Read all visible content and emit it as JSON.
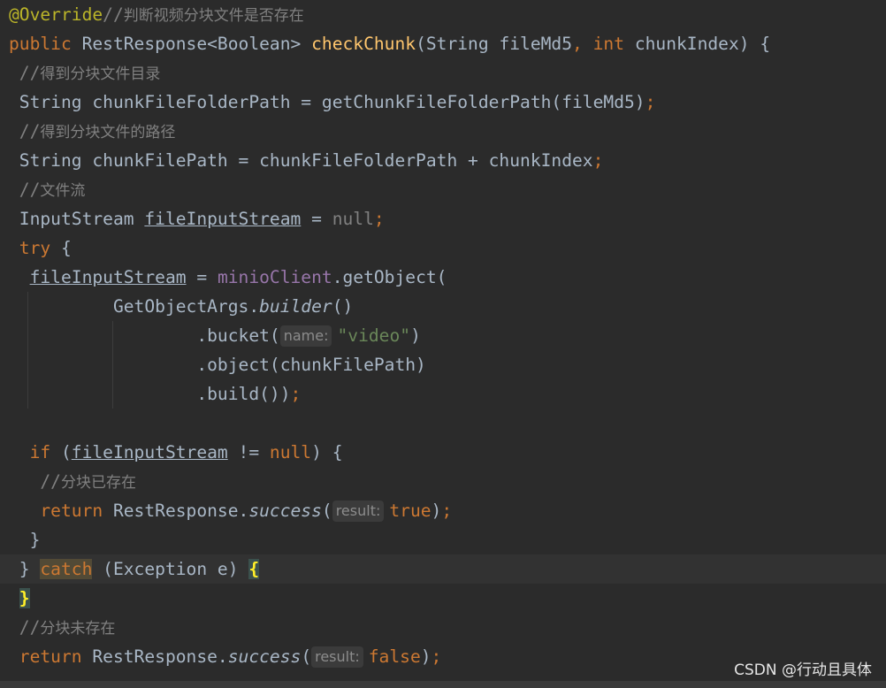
{
  "editor": {
    "lines": [
      {
        "tokens": [
          {
            "c": "ann",
            "t": "@Override"
          },
          {
            "c": "cmt",
            "t": "//"
          },
          {
            "c": "cmt-cjk",
            "t": "判断视频分块文件是否存在"
          }
        ]
      },
      {
        "tokens": [
          {
            "c": "kw",
            "t": "public "
          },
          {
            "c": "",
            "t": "RestResponse<Boolean> "
          },
          {
            "c": "fn",
            "t": "checkChunk"
          },
          {
            "c": "",
            "t": "(String fileMd5"
          },
          {
            "c": "kw",
            "t": ", int "
          },
          {
            "c": "",
            "t": "chunkIndex) {"
          }
        ]
      },
      {
        "tokens": [
          {
            "c": "",
            "t": " "
          },
          {
            "c": "cmt",
            "t": "//"
          },
          {
            "c": "cmt-cjk",
            "t": "得到分块文件目录"
          }
        ]
      },
      {
        "tokens": [
          {
            "c": "",
            "t": " String chunkFileFolderPath = getChunkFileFolderPath(fileMd5)"
          },
          {
            "c": "kw",
            "t": ";"
          }
        ]
      },
      {
        "tokens": [
          {
            "c": "",
            "t": " "
          },
          {
            "c": "cmt",
            "t": "//"
          },
          {
            "c": "cmt-cjk",
            "t": "得到分块文件的路径"
          }
        ]
      },
      {
        "tokens": [
          {
            "c": "",
            "t": " String chunkFilePath = chunkFileFolderPath + chunkIndex"
          },
          {
            "c": "kw",
            "t": ";"
          }
        ]
      },
      {
        "tokens": [
          {
            "c": "",
            "t": " "
          },
          {
            "c": "cmt",
            "t": "//"
          },
          {
            "c": "cmt-cjk",
            "t": "文件流"
          }
        ]
      },
      {
        "tokens": [
          {
            "c": "",
            "t": " InputStream "
          },
          {
            "c": "ul",
            "t": "fileInputStream"
          },
          {
            "c": "",
            "t": " = "
          },
          {
            "c": "nullv",
            "t": "null"
          },
          {
            "c": "kw",
            "t": ";"
          }
        ]
      },
      {
        "tokens": [
          {
            "c": "",
            "t": " "
          },
          {
            "c": "kw",
            "t": "try "
          },
          {
            "c": "",
            "t": "{"
          }
        ]
      },
      {
        "tokens": [
          {
            "c": "",
            "t": "  "
          },
          {
            "c": "ul",
            "t": "fileInputStream"
          },
          {
            "c": "",
            "t": " = "
          },
          {
            "c": "fld",
            "t": "minioClient"
          },
          {
            "c": "",
            "t": ".getObject("
          }
        ]
      },
      {
        "tokens": [
          {
            "c": "",
            "t": "          GetObjectArgs."
          },
          {
            "c": "it",
            "t": "builder"
          },
          {
            "c": "",
            "t": "()"
          }
        ]
      },
      {
        "tokens": [
          {
            "c": "",
            "t": "                  .bucket("
          },
          {
            "c": "hint",
            "t": "name:"
          },
          {
            "c": "str",
            "t": "\"video\""
          },
          {
            "c": "",
            "t": ")"
          }
        ]
      },
      {
        "tokens": [
          {
            "c": "",
            "t": "                  .object(chunkFilePath)"
          }
        ]
      },
      {
        "tokens": [
          {
            "c": "",
            "t": "                  .build())"
          },
          {
            "c": "kw",
            "t": ";"
          }
        ]
      },
      {
        "tokens": []
      },
      {
        "tokens": [
          {
            "c": "",
            "t": "  "
          },
          {
            "c": "kw",
            "t": "if "
          },
          {
            "c": "",
            "t": "("
          },
          {
            "c": "ul",
            "t": "fileInputStream"
          },
          {
            "c": "",
            "t": " != "
          },
          {
            "c": "kw",
            "t": "null"
          },
          {
            "c": "",
            "t": ") {"
          }
        ]
      },
      {
        "tokens": [
          {
            "c": "",
            "t": "   "
          },
          {
            "c": "cmt",
            "t": "//"
          },
          {
            "c": "cmt-cjk",
            "t": "分块已存在"
          }
        ]
      },
      {
        "tokens": [
          {
            "c": "",
            "t": "   "
          },
          {
            "c": "kw",
            "t": "return "
          },
          {
            "c": "",
            "t": "RestResponse."
          },
          {
            "c": "it",
            "t": "success"
          },
          {
            "c": "",
            "t": "("
          },
          {
            "c": "hint",
            "t": "result:"
          },
          {
            "c": "kw",
            "t": "true"
          },
          {
            "c": "",
            "t": ")"
          },
          {
            "c": "kw",
            "t": ";"
          }
        ]
      },
      {
        "tokens": [
          {
            "c": "",
            "t": "  }"
          }
        ]
      },
      {
        "tokens": [
          {
            "c": "",
            "t": " } "
          },
          {
            "c": "kw catchbg",
            "t": "catch"
          },
          {
            "c": "",
            "t": " (Exception e) "
          },
          {
            "c": "bm",
            "t": "{"
          }
        ]
      },
      {
        "tokens": [
          {
            "c": "",
            "t": " "
          },
          {
            "c": "bm",
            "t": "}"
          }
        ]
      },
      {
        "tokens": [
          {
            "c": "",
            "t": " "
          },
          {
            "c": "cmt",
            "t": "//"
          },
          {
            "c": "cmt-cjk",
            "t": "分块未存在"
          }
        ]
      },
      {
        "tokens": [
          {
            "c": "",
            "t": " "
          },
          {
            "c": "kw",
            "t": "return "
          },
          {
            "c": "",
            "t": "RestResponse."
          },
          {
            "c": "it",
            "t": "success"
          },
          {
            "c": "",
            "t": "("
          },
          {
            "c": "hint",
            "t": "result:"
          },
          {
            "c": "kw",
            "t": "false"
          },
          {
            "c": "",
            "t": ")"
          },
          {
            "c": "kw",
            "t": ";"
          }
        ]
      }
    ],
    "highlighted_line": 19
  },
  "watermark": {
    "text": "CSDN @行动且具体"
  },
  "colors": {
    "background": "#2b2b2b",
    "keyword": "#cc7832",
    "annotation": "#bbb529",
    "comment": "#808080",
    "method_declaration": "#ffc66d",
    "string": "#6a8759",
    "field": "#9876aa",
    "default_text": "#a9b7c6"
  }
}
